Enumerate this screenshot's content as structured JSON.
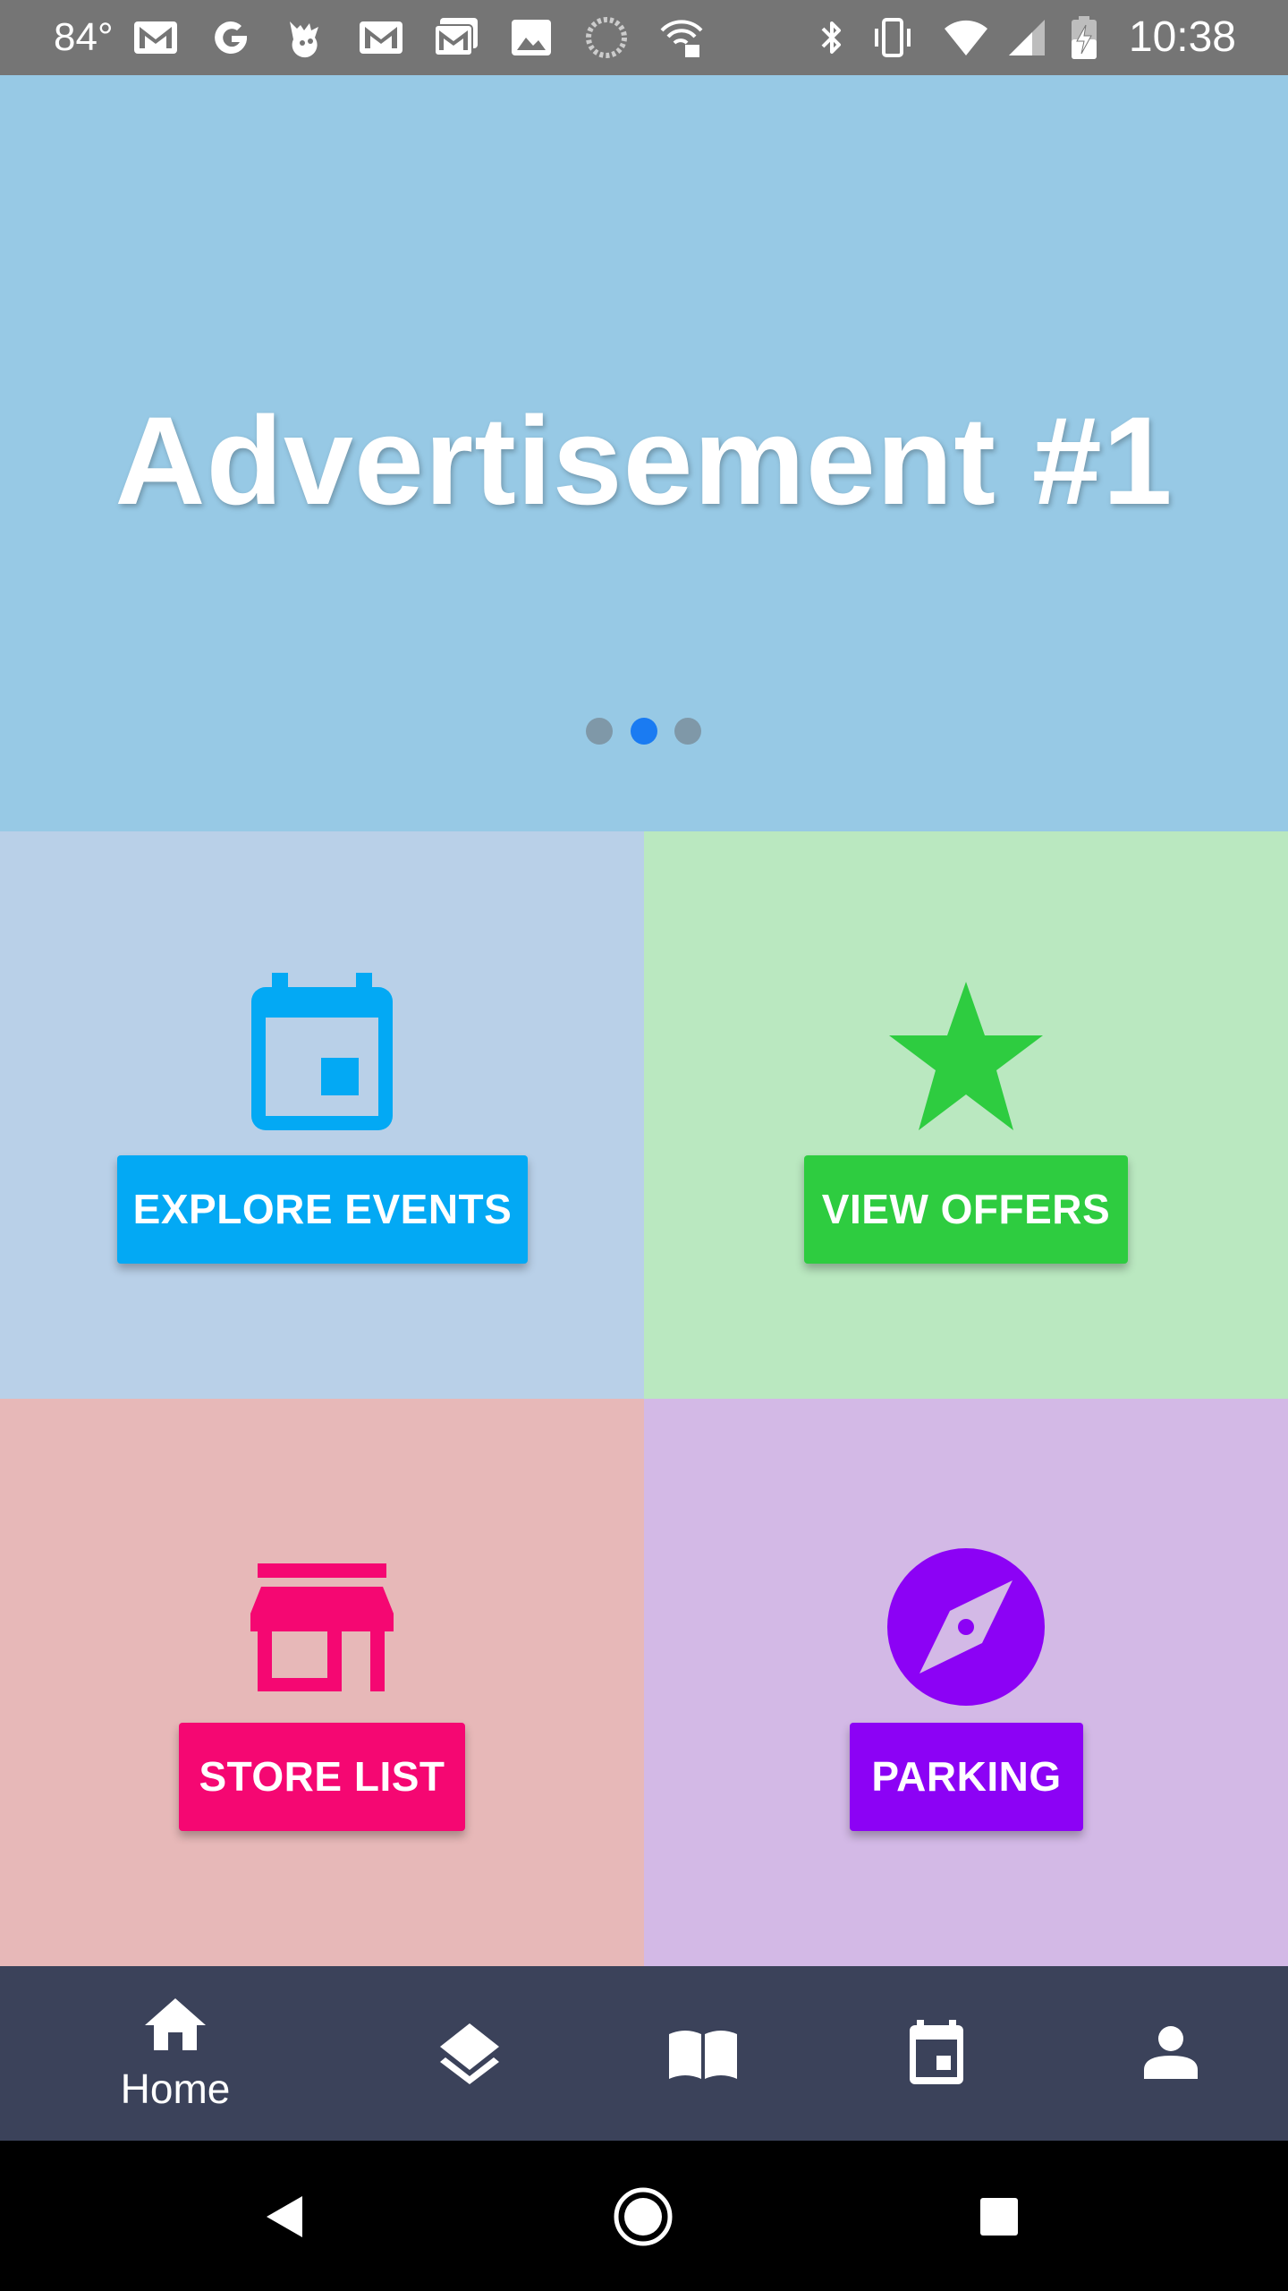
{
  "status_bar": {
    "temperature": "84°",
    "time": "10:38",
    "icons": [
      "gmail-icon",
      "google-icon",
      "pokemon-icon",
      "gmail-icon",
      "gmail-stack-icon",
      "image-icon",
      "sync-icon",
      "wifi-lock-icon",
      "bluetooth-icon",
      "vibrate-icon",
      "wifi-icon",
      "cellular-icon",
      "battery-charging-icon"
    ]
  },
  "banner": {
    "title": "Advertisement #1",
    "pager": {
      "count": 3,
      "active_index": 1
    },
    "colors": {
      "background": "#97c9e5",
      "dot": "#7f98a8",
      "dot_active": "#1a7bf2"
    }
  },
  "tiles": {
    "events": {
      "label": "EXPLORE EVENTS",
      "icon": "calendar-icon",
      "color": "#03a9f4",
      "background": "#b9d0e8"
    },
    "offers": {
      "label": "VIEW OFFERS",
      "icon": "star-icon",
      "color": "#2ecc40",
      "background": "#bae8c0"
    },
    "stores": {
      "label": "STORE LIST",
      "icon": "store-icon",
      "color": "#f50772",
      "background": "#e7b8b8"
    },
    "parking": {
      "label": "PARKING",
      "icon": "compass-icon",
      "color": "#8c02f5",
      "background": "#d3b9e6"
    }
  },
  "bottom_nav": {
    "active": "home",
    "items": [
      {
        "id": "home",
        "label": "Home",
        "icon": "home-icon"
      },
      {
        "id": "layers",
        "label": "",
        "icon": "layers-icon"
      },
      {
        "id": "directory",
        "label": "",
        "icon": "book-icon"
      },
      {
        "id": "calendar",
        "label": "",
        "icon": "calendar-icon"
      },
      {
        "id": "profile",
        "label": "",
        "icon": "person-icon"
      }
    ]
  },
  "system_nav": {
    "buttons": [
      "back-icon",
      "home-circle-icon",
      "recents-icon"
    ]
  }
}
